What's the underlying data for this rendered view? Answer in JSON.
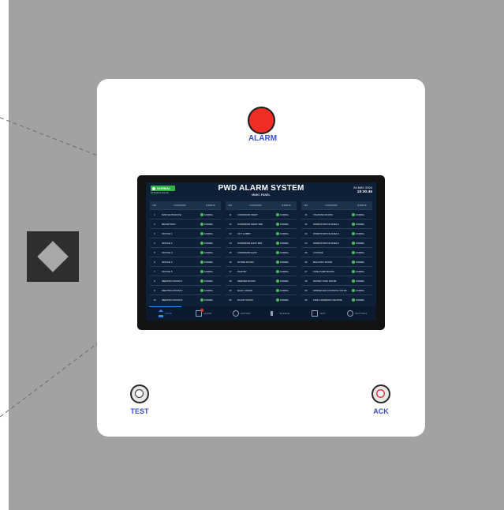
{
  "labels": {
    "alarm": "ALARM",
    "test": "TEST",
    "ack": "ACK"
  },
  "header": {
    "status": "NORMAL",
    "status_sub": "All Systems Normal",
    "title": "PWD ALARM SYSTEM",
    "subtitle": "MIMIC PANEL",
    "date": "24 MAY 2024",
    "time": "10:30:45"
  },
  "columns": {
    "no": "NO.",
    "location": "LOCATION",
    "status": "STATUS"
  },
  "zones": [
    {
      "no": "1",
      "location": "MAIN ENTRANCE",
      "status": "NORMAL"
    },
    {
      "no": "2",
      "location": "RECEPTION",
      "status": "NORMAL"
    },
    {
      "no": "3",
      "location": "OFFICE 1",
      "status": "NORMAL"
    },
    {
      "no": "4",
      "location": "OFFICE 2",
      "status": "NORMAL"
    },
    {
      "no": "5",
      "location": "OFFICE 3",
      "status": "NORMAL"
    },
    {
      "no": "6",
      "location": "OFFICE 4",
      "status": "NORMAL"
    },
    {
      "no": "7",
      "location": "OFFICE 5",
      "status": "NORMAL"
    },
    {
      "no": "8",
      "location": "MEETING ROOM 1",
      "status": "NORMAL"
    },
    {
      "no": "9",
      "location": "MEETING ROOM 2",
      "status": "NORMAL"
    },
    {
      "no": "10",
      "location": "MEETING ROOM 3",
      "status": "NORMAL"
    },
    {
      "no": "11",
      "location": "CORRIDOR WEST",
      "status": "NORMAL"
    },
    {
      "no": "12",
      "location": "CORRIDOR WEST MID",
      "status": "NORMAL"
    },
    {
      "no": "13",
      "location": "LIFT LOBBY",
      "status": "NORMAL"
    },
    {
      "no": "14",
      "location": "CORRIDOR EAST MID",
      "status": "NORMAL"
    },
    {
      "no": "15",
      "location": "CORRIDOR EAST",
      "status": "NORMAL"
    },
    {
      "no": "16",
      "location": "STORE ROOM",
      "status": "NORMAL"
    },
    {
      "no": "17",
      "location": "PANTRY",
      "status": "NORMAL"
    },
    {
      "no": "18",
      "location": "SERVER ROOM",
      "status": "NORMAL"
    },
    {
      "no": "19",
      "location": "ELEC. ROOM",
      "status": "NORMAL"
    },
    {
      "no": "20",
      "location": "PLANT ROOM",
      "status": "NORMAL"
    },
    {
      "no": "21",
      "location": "TRAINING ROOM",
      "status": "NORMAL"
    },
    {
      "no": "22",
      "location": "WORKSTATION AREA 1",
      "status": "NORMAL"
    },
    {
      "no": "23",
      "location": "WORKSTATION AREA 2",
      "status": "NORMAL"
    },
    {
      "no": "24",
      "location": "WORKSTATION AREA 3",
      "status": "NORMAL"
    },
    {
      "no": "25",
      "location": "LOUNGE",
      "status": "NORMAL"
    },
    {
      "no": "26",
      "location": "BALCONY DOOR",
      "status": "NORMAL"
    },
    {
      "no": "27",
      "location": "FIRE PUMP ROOM",
      "status": "NORMAL"
    },
    {
      "no": "28",
      "location": "WATER TANK ROOM",
      "status": "NORMAL"
    },
    {
      "no": "29",
      "location": "SPRINKLER CONTROL VALVE",
      "status": "NORMAL"
    },
    {
      "no": "30",
      "location": "FIRE COMMAND CENTRE",
      "status": "NORMAL"
    }
  ],
  "nav": [
    {
      "label": "HOME",
      "icon": "home-icon"
    },
    {
      "label": "ALARM",
      "icon": "alarm-icon"
    },
    {
      "label": "HISTORY",
      "icon": "history-icon"
    },
    {
      "label": "SILENCE",
      "icon": "speaker-icon"
    },
    {
      "label": "TEST",
      "icon": "test-icon"
    },
    {
      "label": "SETTINGS",
      "icon": "gear-icon"
    }
  ],
  "colors": {
    "alarm_lamp": "#ee2d24",
    "status_ok": "#2fb344",
    "label_blue": "#3a4fd6",
    "screen_bg": "#0e2038",
    "active_nav": "#2f8af5"
  }
}
